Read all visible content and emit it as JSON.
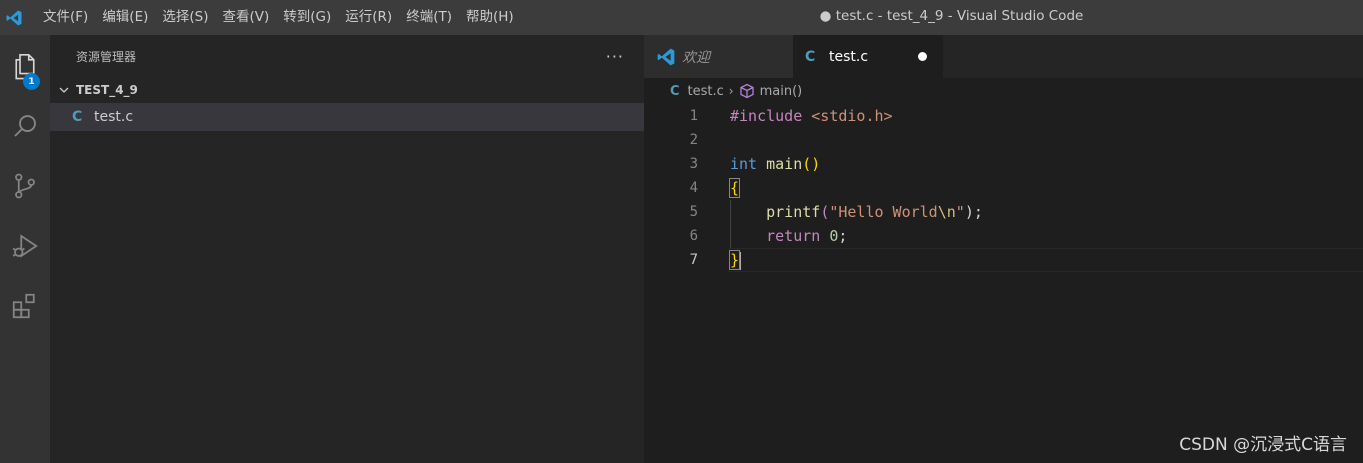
{
  "titlebar": {
    "menu": [
      "文件(F)",
      "编辑(E)",
      "选择(S)",
      "查看(V)",
      "转到(G)",
      "运行(R)",
      "终端(T)",
      "帮助(H)"
    ],
    "window_title": "● test.c - test_4_9 - Visual Studio Code"
  },
  "activitybar": {
    "items": [
      "explorer-icon",
      "search-icon",
      "source-control-icon",
      "run-debug-icon",
      "extensions-icon"
    ],
    "explorer_badge": "1",
    "accent": "#007acc"
  },
  "sidebar": {
    "title": "资源管理器",
    "more": "···",
    "folder": "TEST_4_9",
    "files": [
      {
        "icon": "C",
        "name": "test.c"
      }
    ]
  },
  "editor": {
    "tabs": [
      {
        "label": "欢迎",
        "icon": "vscode-logo-icon",
        "active": false
      },
      {
        "label": "test.c",
        "icon": "C",
        "active": true,
        "dirty": true
      }
    ],
    "breadcrumb": {
      "file_icon": "C",
      "file": "test.c",
      "separator": "›",
      "symbol": "main()"
    },
    "lines": [
      {
        "no": "1",
        "text": "#include <stdio.h>"
      },
      {
        "no": "2",
        "text": ""
      },
      {
        "no": "3",
        "text": "int main()"
      },
      {
        "no": "4",
        "text": "{"
      },
      {
        "no": "5",
        "text": "    printf(\"Hello World\\n\");"
      },
      {
        "no": "6",
        "text": "    return 0;"
      },
      {
        "no": "7",
        "text": "}"
      }
    ],
    "current_line": "7",
    "tokens": {
      "include_kw": "#include",
      "include_file": "<stdio.h>",
      "int_kw": "int",
      "main_fn": "main",
      "parens": "()",
      "open_brace": "{",
      "printf_fn": "printf",
      "open_paren": "(",
      "str_start": "\"Hello World",
      "str_esc": "\\n",
      "str_end": "\"",
      "close_stmt": ");",
      "return_kw": "return",
      "zero": "0",
      "semicolon": ";",
      "close_brace": "}"
    }
  },
  "watermark": "CSDN @沉浸式C语言"
}
